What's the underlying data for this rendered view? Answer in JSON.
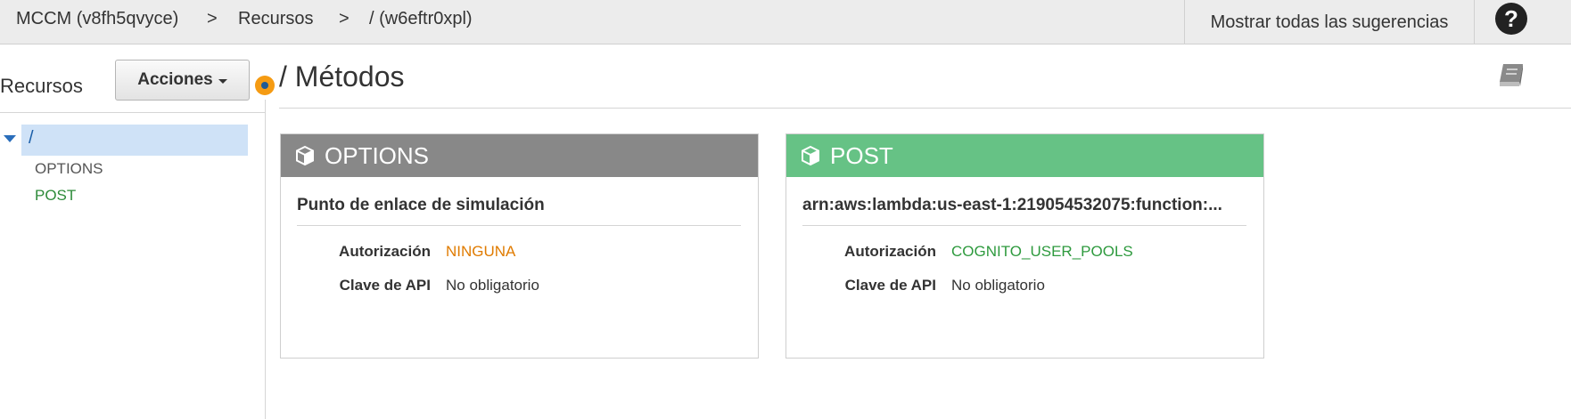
{
  "breadcrumb": {
    "api": "MCCM (v8fh5qvyce)",
    "sep1": ">",
    "section": "Recursos",
    "sep2": ">",
    "resource": "/ (w6eftr0xpl)"
  },
  "header": {
    "suggestions_label": "Mostrar todas las sugerencias",
    "help_label": "?"
  },
  "sidebar": {
    "title": "Recursos",
    "actions_label": "Acciones",
    "tree": {
      "root": "/",
      "items": [
        {
          "label": "OPTIONS",
          "color": "#555555"
        },
        {
          "label": "POST",
          "color": "#2e8b3a"
        }
      ]
    }
  },
  "main": {
    "title": "/ Métodos",
    "icon": "book-icon",
    "cards": [
      {
        "method": "OPTIONS",
        "header_color": "#888888",
        "integration": "Punto de enlace de simulación",
        "auth_label": "Autorización",
        "auth_value": "NINGUNA",
        "auth_color": "#e07b00",
        "apikey_label": "Clave de API",
        "apikey_value": "No obligatorio"
      },
      {
        "method": "POST",
        "header_color": "#66c285",
        "integration": "arn:aws:lambda:us-east-1:219054532075:function:...",
        "auth_label": "Autorización",
        "auth_value": "COGNITO_USER_POOLS",
        "auth_color": "#2e9a3e",
        "apikey_label": "Clave de API",
        "apikey_value": "No obligatorio"
      }
    ]
  }
}
